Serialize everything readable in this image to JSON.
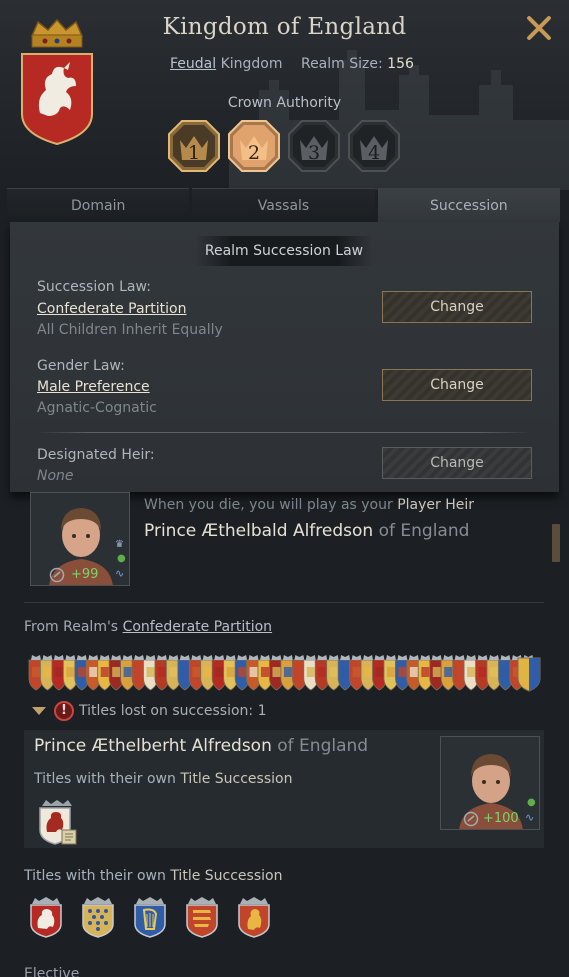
{
  "header": {
    "title": "Kingdom of England",
    "government_link": "Feudal",
    "government_suffix": "Kingdom",
    "realm_size_label": "Realm Size:",
    "realm_size_value": "156",
    "crown_authority_label": "Crown Authority",
    "crown_authority_levels": [
      {
        "label": "1",
        "state": "achieved"
      },
      {
        "label": "2",
        "state": "current"
      },
      {
        "label": "3",
        "state": "locked"
      },
      {
        "label": "4",
        "state": "locked"
      }
    ]
  },
  "tabs": [
    {
      "label": "Domain",
      "active": false
    },
    {
      "label": "Vassals",
      "active": false
    },
    {
      "label": "Succession",
      "active": true
    }
  ],
  "succession": {
    "section_title": "Realm Succession Law",
    "succession_law_label": "Succession Law:",
    "succession_law_value": "Confederate Partition",
    "succession_law_desc": "All Children Inherit Equally",
    "gender_law_label": "Gender Law:",
    "gender_law_value": "Male Preference",
    "gender_law_desc": "Agnatic-Cognatic",
    "designated_heir_label": "Designated Heir:",
    "designated_heir_value": "None",
    "change_label": "Change"
  },
  "player_heir": {
    "note_prefix": "When you die, you will play as your",
    "note_link": "Player Heir",
    "name": "Prince Æthelbald Alfredson",
    "of_text": "of England",
    "opinion": "+99"
  },
  "partition": {
    "prefix": "From Realm's",
    "link": "Confederate Partition",
    "lost_label": "Titles lost on succession: 1"
  },
  "sibling": {
    "name": "Prince Æthelberht Alfredson",
    "of_text": "of England",
    "sub_prefix": "Titles with their own",
    "sub_link": "Title Succession",
    "opinion": "+100"
  },
  "own_titles": {
    "prefix": "Titles with their own",
    "link": "Title Succession"
  },
  "bottom_text": "Elective",
  "colors": {
    "accent_gold": "#c89a55",
    "current_level": "#e0a36d",
    "positive": "#7ed36a",
    "warning_red": "#c9473e"
  }
}
